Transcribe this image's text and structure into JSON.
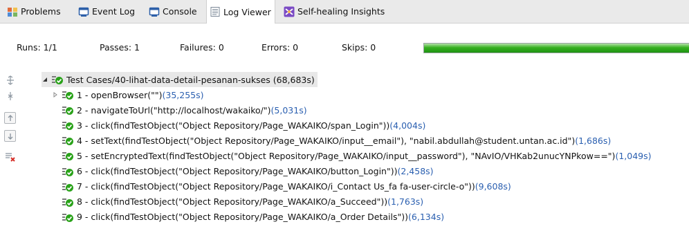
{
  "tabs": [
    {
      "label": "Problems",
      "icon": "problems-icon"
    },
    {
      "label": "Event Log",
      "icon": "event-log-icon"
    },
    {
      "label": "Console",
      "icon": "console-icon"
    },
    {
      "label": "Log Viewer",
      "icon": "log-viewer-icon",
      "active": true
    },
    {
      "label": "Self-healing Insights",
      "icon": "self-healing-icon"
    }
  ],
  "stats": {
    "runs": "Runs: 1/1",
    "passes": "Passes: 1",
    "failures": "Failures: 0",
    "errors": "Errors: 0",
    "skips": "Skips: 0",
    "progress_fraction": 1.0,
    "progress_color": "#2aa21a"
  },
  "toolbar": [
    {
      "name": "expand-all-icon"
    },
    {
      "name": "collapse-all-icon"
    },
    {
      "name": "previous-failure-icon"
    },
    {
      "name": "next-failure-icon"
    },
    {
      "name": "show-failures-only-icon"
    }
  ],
  "tree": {
    "root": {
      "label": "Test Cases/40-lihat-data-detail-pesanan-sukses (68,683s)",
      "status": "passed",
      "expanded": true
    },
    "steps": [
      {
        "text": "1 - openBrowser(\"\")",
        "duration": "(35,255s)",
        "collapsed": true
      },
      {
        "text": "2 - navigateToUrl(\"http://localhost/wakaiko/\")",
        "duration": "(5,031s)"
      },
      {
        "text": "3 - click(findTestObject(\"Object Repository/Page_WAKAIKO/span_Login\"))",
        "duration": "(4,004s)"
      },
      {
        "text": "4 - setText(findTestObject(\"Object Repository/Page_WAKAIKO/input__email\"), \"nabil.abdullah@student.untan.ac.id\")",
        "duration": "(1,686s)"
      },
      {
        "text": "5 - setEncryptedText(findTestObject(\"Object Repository/Page_WAKAIKO/input__password\"), \"NAvIO/VHKab2unucYNPkow==\")",
        "duration": "(1,049s)"
      },
      {
        "text": "6 - click(findTestObject(\"Object Repository/Page_WAKAIKO/button_Login\"))",
        "duration": "(2,458s)"
      },
      {
        "text": "7 - click(findTestObject(\"Object Repository/Page_WAKAIKO/i_Contact Us_fa fa-user-circle-o\"))",
        "duration": "(9,608s)"
      },
      {
        "text": "8 - click(findTestObject(\"Object Repository/Page_WAKAIKO/a_Succeed\"))",
        "duration": "(1,763s)"
      },
      {
        "text": "9 - click(findTestObject(\"Object Repository/Page_WAKAIKO/a_Order Details\"))",
        "duration": "(6,134s)"
      }
    ]
  },
  "colors": {
    "pass_green": "#2aa21a",
    "duration_blue": "#2a5fb0"
  }
}
